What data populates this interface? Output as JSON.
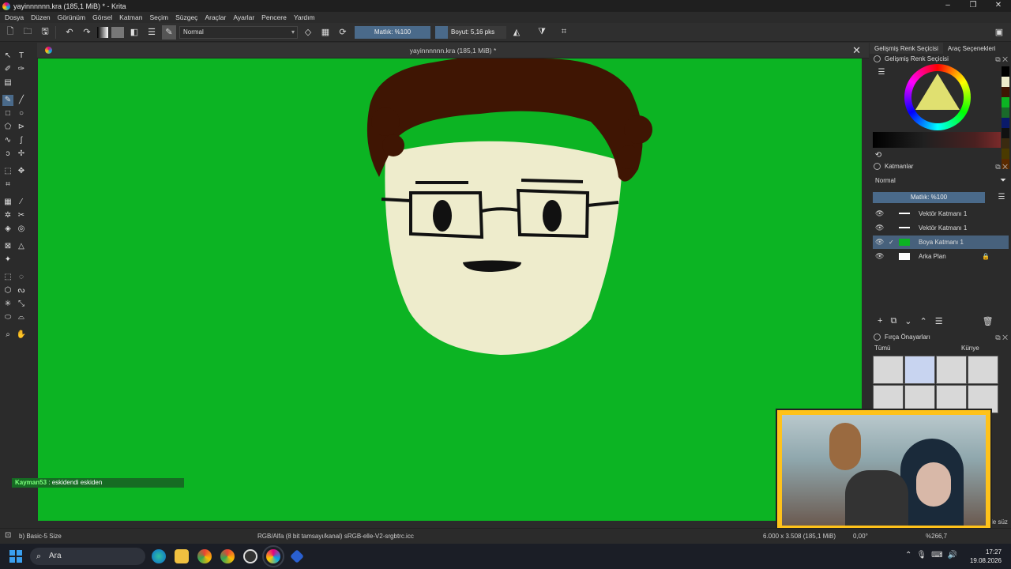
{
  "window": {
    "title": "yayinnnnnn.kra (185,1 MiB) * - Krita",
    "controls": [
      "–",
      "❐",
      "✕"
    ]
  },
  "menu": [
    "Dosya",
    "Düzen",
    "Görünüm",
    "Görsel",
    "Katman",
    "Seçim",
    "Süzgeç",
    "Araçlar",
    "Ayarlar",
    "Pencere",
    "Yardım"
  ],
  "toolbar": {
    "blend_mode": "Normal",
    "opacity": "Matlık: %100",
    "size": "Boyut: 5,16 pks"
  },
  "document": {
    "tab_title": "yayinnnnnn.kra (185,1 MiB) *"
  },
  "chat": {
    "user": "Kayman53",
    "separator": " : ",
    "message": "eskidendi eskiden"
  },
  "right_panel": {
    "tabs": [
      "Gelişmiş Renk Seçicisi",
      "Araç Seçenekleri"
    ],
    "color_dock_title": "Gelişmiş Renk Seçicisi",
    "layers_dock_title": "Katmanlar",
    "layers_blend": "Normal",
    "layers_opacity": "Matlık: %100",
    "layers": [
      {
        "name": "Vektör Katmanı 1",
        "selected": false
      },
      {
        "name": "Vektör Katmanı 1",
        "selected": false
      },
      {
        "name": "Boya Katmanı 1",
        "selected": true
      },
      {
        "name": "Arka Plan",
        "selected": false
      }
    ],
    "brush_dock_title": "Fırça Önayarları",
    "brush_filter": "Tümü",
    "brush_tag": "Künye",
    "filter_fragment": "le süz"
  },
  "status": {
    "brush": "b) Basic-5 Size",
    "color_space": "RGB/Alfa (8 bit tamsayı/kanal)  sRGB-elle-V2-srgbtrc.icc",
    "dimensions": "6.000 x 3.508 (185,1 MiB)",
    "rotation": "0,00°",
    "zoom": "%266,7"
  },
  "taskbar": {
    "search": "Ara",
    "time": "17:27",
    "date": "19.08.2026"
  },
  "colors": {
    "canvas": "#0cb423",
    "hair": "#3f1503",
    "skin": "#eeeccc",
    "accent": "#4a6a8a"
  }
}
